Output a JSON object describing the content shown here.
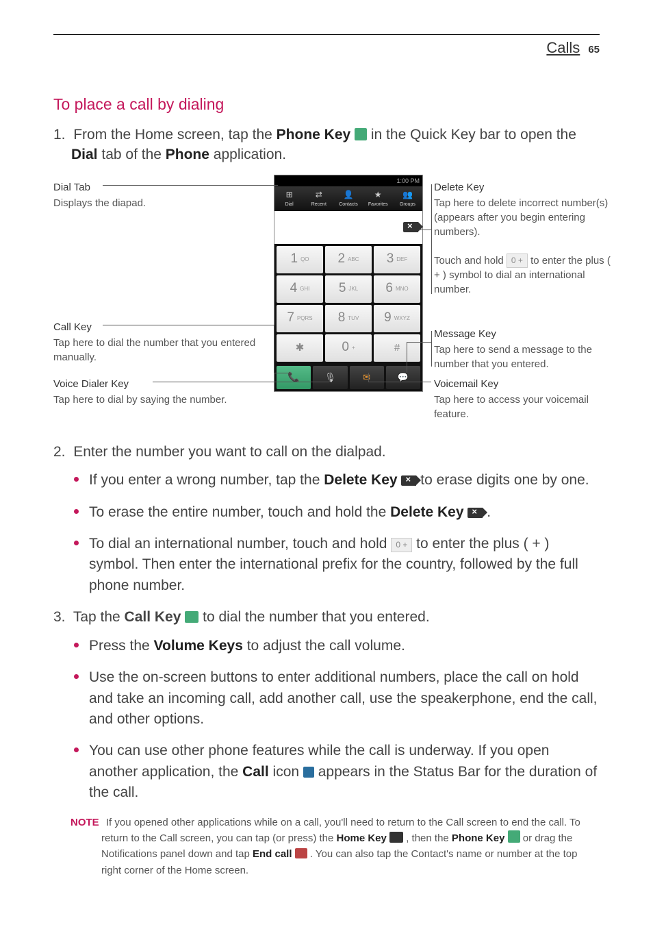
{
  "header": {
    "title": "Calls",
    "page": "65"
  },
  "section_title": "To place a call by dialing",
  "step1": {
    "num": "1.",
    "t1": "From the Home screen, tap the ",
    "b1": "Phone Key ",
    "t2": " in the Quick Key bar to open the ",
    "b2": "Dial",
    "t3": " tab of the ",
    "b3": "Phone",
    "t4": " application."
  },
  "callouts": {
    "dial_tab": {
      "title": "Dial Tab",
      "body": "Displays the diapad."
    },
    "call_key": {
      "title": "Call Key",
      "body": "Tap here to dial the number that you entered manually."
    },
    "voice": {
      "title": "Voice Dialer Key",
      "body": "Tap here to dial by saying the number."
    },
    "delete": {
      "title": "Delete Key",
      "b1": "Tap here to delete incorrect number(s) (appears after you begin entering numbers).",
      "b2a": "Touch and hold ",
      "b2b": " to enter the plus ( + ) symbol to dial an international number."
    },
    "message": {
      "title": "Message Key",
      "body": "Tap here to send a message to the number that you entered."
    },
    "voicemail": {
      "title": "Voicemail Key",
      "body": "Tap here to access your voicemail feature."
    }
  },
  "phone": {
    "status_time": "1:00 PM",
    "tabs": [
      "Dial",
      "Recent",
      "Contacts",
      "Favorites",
      "Groups"
    ],
    "tab_icons": [
      "⊞",
      "⇄",
      "👤",
      "★",
      "👥"
    ],
    "keys": [
      {
        "n": "1",
        "s": "QO"
      },
      {
        "n": "2",
        "s": "ABC"
      },
      {
        "n": "3",
        "s": "DEF"
      },
      {
        "n": "4",
        "s": "GHI"
      },
      {
        "n": "5",
        "s": "JKL"
      },
      {
        "n": "6",
        "s": "MNO"
      },
      {
        "n": "7",
        "s": "PQRS"
      },
      {
        "n": "8",
        "s": "TUV"
      },
      {
        "n": "9",
        "s": "WXYZ"
      },
      {
        "n": "✱",
        "s": ""
      },
      {
        "n": "0",
        "s": "+"
      },
      {
        "n": "#",
        "s": ""
      }
    ],
    "bottom_icons": {
      "call": "📞",
      "voice": "🎙",
      "mail": "✉",
      "msg": "💬"
    }
  },
  "step2": {
    "num": "2.",
    "text": "Enter the number you want to call on the dialpad."
  },
  "b2": {
    "i1a": "If you enter a wrong number, tap the ",
    "i1b": "Delete Key ",
    "i1c": " to erase digits one by one.",
    "i2a": "To erase the entire number, touch and hold the ",
    "i2b": "Delete Key ",
    "i2c": ".",
    "i3a": "To dial an international number, touch and hold ",
    "i3b": " to enter the plus ( + ) symbol. Then enter the international prefix for the country, followed by the full phone number."
  },
  "step3": {
    "num": "3.",
    "t1": "Tap the ",
    "b1": "Call Key ",
    "t2": " to dial the number that you entered."
  },
  "b3": {
    "i1a": "Press the ",
    "i1b": "Volume Keys",
    "i1c": " to adjust the call volume.",
    "i2": "Use the on-screen buttons to enter additional numbers, place the call on hold and take an incoming call, add another call, use the speakerphone, end the call, and other options.",
    "i3a": "You can use other phone features while the call is underway. If you open another application, the ",
    "i3b": "Call",
    "i3c": " icon ",
    "i3d": " appears in the Status Bar for the duration of the call."
  },
  "note": {
    "label": "NOTE",
    "t1": "If you opened other applications while on a call, you'll need to return to the Call screen to end the call. To return to the Call screen, you can tap (or press) the ",
    "b1": "Home Key ",
    "t2": ", then the ",
    "b2": "Phone Key ",
    "t3": " or drag the Notifications panel down and tap ",
    "b3": "End call ",
    "t4": ". You can also tap the Contact's name or number at the top right corner of the Home screen."
  },
  "zero_key_label": "0 +"
}
